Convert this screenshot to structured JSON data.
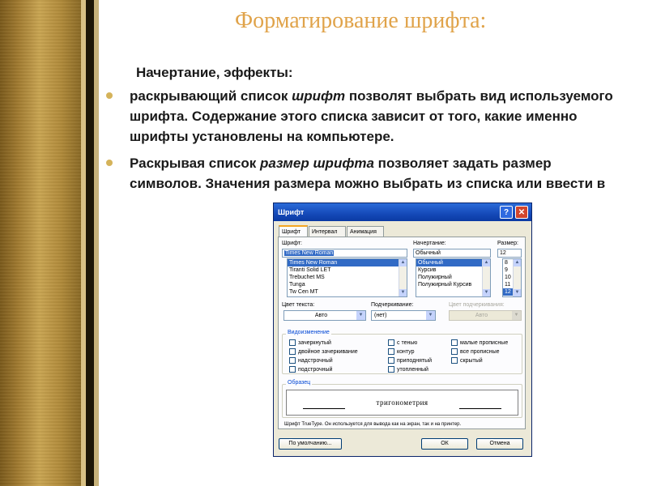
{
  "slide": {
    "title": "Форматирование шрифта:",
    "subheading": "Начертание, эффекты:",
    "bullets": [
      {
        "before": "раскрывающий список ",
        "emphasis": "шрифт",
        "after": " позволят выбрать вид используемого шрифта. Содержание этого списка зависит от того, какие именно шрифты установлены на компьютере."
      },
      {
        "before": "Раскрывая список ",
        "emphasis": "размер шрифта",
        "after": " позволяет задать размер символов. Значения размера можно выбрать из списка или ввести в ручную."
      }
    ]
  },
  "dialog": {
    "title": "Шрифт",
    "help_icon": "?",
    "close_icon": "✕",
    "tabs": [
      "Шрифт",
      "Интервал",
      "Анимация"
    ],
    "font": {
      "label": "Шрифт:",
      "value": "Times New Roman",
      "options": [
        "Times New Roman",
        "Tiranti Solid LET",
        "Trebuchet MS",
        "Tunga",
        "Tw Cen MT"
      ]
    },
    "style": {
      "label": "Начертание:",
      "value": "Обычный",
      "options": [
        "Обычный",
        "Курсив",
        "Полужирный",
        "Полужирный Курсив"
      ]
    },
    "size": {
      "label": "Размер:",
      "value": "12",
      "options": [
        "8",
        "9",
        "10",
        "11",
        "12"
      ]
    },
    "text_color": {
      "label": "Цвет текста:",
      "value": "Авто"
    },
    "underline": {
      "label": "Подчеркивание:",
      "value": "(нет)"
    },
    "underline_color": {
      "label": "Цвет подчеркивания:",
      "value": "Авто"
    },
    "effects": {
      "label": "Видоизменение",
      "items": [
        "зачеркнутый",
        "двойное зачеркивание",
        "надстрочный",
        "подстрочный",
        "с тенью",
        "контур",
        "приподнятый",
        "утопленный",
        "малые прописные",
        "все прописные",
        "скрытый"
      ]
    },
    "sample": {
      "label": "Образец",
      "text": "тригонометрия",
      "note": "Шрифт TrueType. Он используется для вывода как на экран, так и на принтер."
    },
    "buttons": {
      "default": "По умолчанию...",
      "ok": "ОК",
      "cancel": "Отмена"
    },
    "dropdown_glyph": "▼",
    "scroll_up_glyph": "▲",
    "scroll_down_glyph": "▼"
  },
  "colors": {
    "title": "#e0a34a",
    "bullet": "#d5b35a",
    "xp_titlebar": "#1549b8",
    "selection": "#316ac5"
  }
}
